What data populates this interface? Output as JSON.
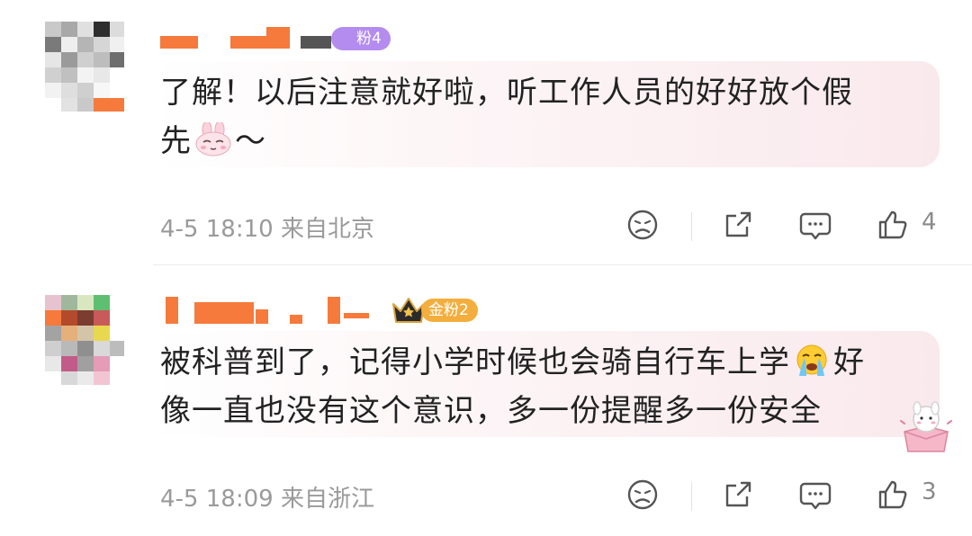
{
  "comments": [
    {
      "badge": "粉4",
      "text_line1": "了解！以后注意就好啦，听工作人员的好好放个假",
      "text_line2_before": "先",
      "text_line2_after": "～",
      "inline_emoji": "rabbit-emoji",
      "timestamp": "4-5 18:10",
      "location": "来自北京",
      "like_count": "4"
    },
    {
      "badge": "金粉2",
      "text_line1_before": "被科普到了，记得小学时候也会骑自行车上学",
      "text_line1_after": "好",
      "text_line2": "像一直也没有这个意识，多一份提醒多一份安全",
      "inline_emoji": "crying-emoji",
      "timestamp": "4-5 18:09",
      "location": "来自浙江",
      "like_count": "3"
    }
  ],
  "colors": {
    "badge_purple": "#b48cf0",
    "badge_gold": "#f3ae3d",
    "name_orange": "#f57a3b",
    "meta_gray": "#9a9a9a"
  },
  "icons": [
    "dislike-face-icon",
    "share-icon",
    "comment-icon",
    "like-thumb-icon"
  ]
}
